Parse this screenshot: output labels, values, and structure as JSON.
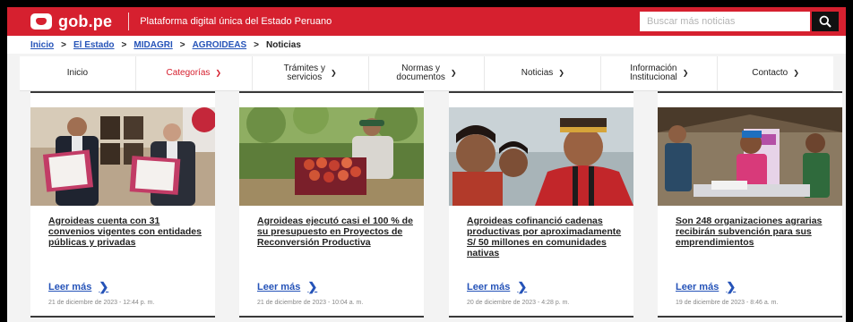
{
  "header": {
    "logo_text": "gob.pe",
    "tagline": "Plataforma digital única del Estado Peruano",
    "search_placeholder": "Buscar más noticias",
    "brand_color": "#d6202f"
  },
  "breadcrumb": {
    "items": [
      "Inicio",
      "El Estado",
      "MIDAGRI",
      "AGROIDEAS"
    ],
    "current": "Noticias"
  },
  "nav": {
    "items": [
      {
        "label_1": "Inicio",
        "label_2": ""
      },
      {
        "label_1": "Categorías",
        "label_2": ""
      },
      {
        "label_1": "Trámites y",
        "label_2": "servicios"
      },
      {
        "label_1": "Normas y",
        "label_2": "documentos"
      },
      {
        "label_1": "Noticias",
        "label_2": ""
      },
      {
        "label_1": "Información",
        "label_2": "Institucional"
      },
      {
        "label_1": "Contacto",
        "label_2": ""
      }
    ]
  },
  "news": [
    {
      "title": "Agroideas cuenta con 31 convenios vigentes con entidades públicas y privadas",
      "read_more": "Leer más",
      "date": "21 de diciembre de 2023 - 12:44 p. m."
    },
    {
      "title": "Agroideas ejecutó casi el 100 % de su presupuesto en Proyectos de Reconversión Productiva",
      "read_more": "Leer más",
      "date": "21 de diciembre de 2023 - 10:04 a. m."
    },
    {
      "title": "Agroideas cofinanció cadenas productivas por aproximadamente S/ 50 millones en comunidades nativas",
      "read_more": "Leer más",
      "date": "20 de diciembre de 2023 - 4:28 p. m."
    },
    {
      "title": "Son 248 organizaciones agrarias recibirán subvención para sus emprendimientos",
      "read_more": "Leer más",
      "date": "19 de diciembre de 2023 - 8:46 a. m."
    }
  ]
}
